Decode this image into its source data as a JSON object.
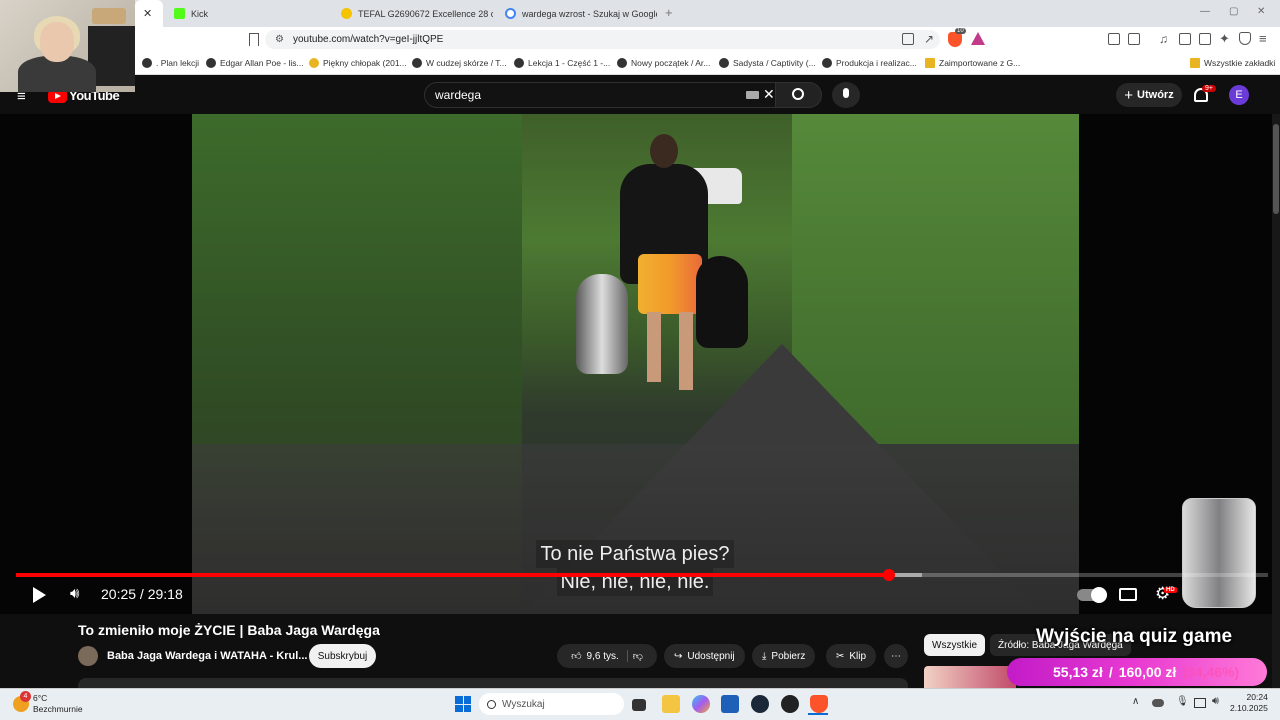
{
  "browser": {
    "tabs": [
      {
        "label": "Kick",
        "color": "#53fc18"
      },
      {
        "label": "TEFAL G2690672 Excellence 28 cm B...",
        "color": "#f5c400"
      },
      {
        "label": "wardega wzrost - Szukaj w Google",
        "color": "#4285f4"
      }
    ],
    "url": "youtube.com/watch?v=geI-jjltQPE",
    "bookmarks": [
      ". Plan lekcji",
      "Edgar Allan Poe - lis...",
      "Piękny chłopak (201...",
      "W cudzej skórze / T...",
      "Lekcja 1 - Część 1 -...",
      "Nowy początek / Ar...",
      "Sadysta / Captivity (...",
      "Produkcja i realizac...",
      "Zaimportowane z G...",
      "Wszystkie zakładki"
    ],
    "brave_badge": "10"
  },
  "youtube": {
    "logo": "YouTube",
    "search_value": "wardega",
    "create_label": "Utwórz",
    "notif_badge": "9+",
    "avatar_letter": "E"
  },
  "player": {
    "subtitle_line1": "To nie Państwa pies?",
    "subtitle_line2": "Nie, nie, nie, nie.",
    "time": "20:25 / 29:18",
    "progress_fraction": 0.6974,
    "buffered_fraction": 0.7235,
    "hd_badge": "HD"
  },
  "video_info": {
    "title": "To zmieniło moje ŻYCIE | Baba Jaga Wardęga",
    "channel": "Baba Jaga Wardega i WATAHA - Krul...",
    "subscribe": "Subskrybuj",
    "likes": "9,6 tys.",
    "share": "Udostępnij",
    "download": "Pobierz",
    "clip": "Klip"
  },
  "chips": {
    "all": "Wszystkie",
    "source": "Źródło: Baba Jaga Wardęga"
  },
  "overlays": {
    "quiz_text": "Wyjście na quiz game",
    "donation_current": "55,13 zł",
    "donation_goal": "160,00 zł",
    "donation_percent": "(34,46%)"
  },
  "taskbar": {
    "temp": "6°C",
    "weather": "Bezchmurnie",
    "weather_badge": "4",
    "search_placeholder": "Wyszukaj",
    "time": "20:24",
    "date": "2.10.2025"
  }
}
